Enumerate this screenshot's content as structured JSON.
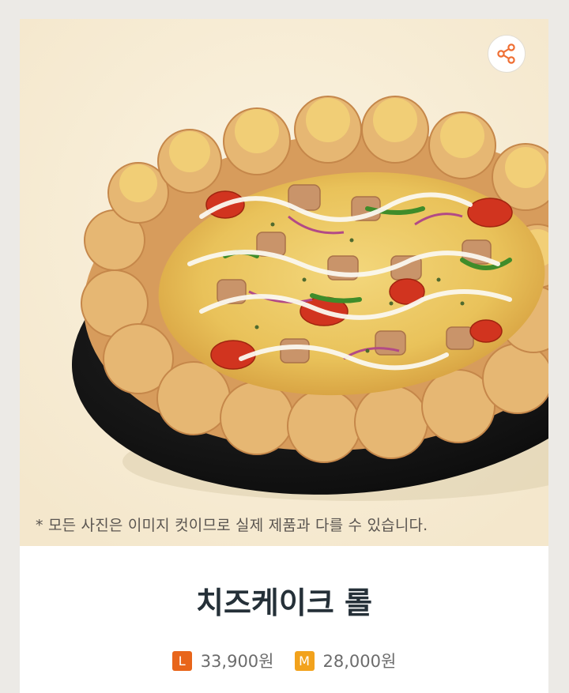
{
  "product": {
    "name": "치즈케이크 롤",
    "disclaimer": "* 모든 사진은 이미지 컷이므로 실제 제품과 다를 수 있습니다.",
    "image_alt": "pizza-photo"
  },
  "prices": [
    {
      "size": "L",
      "price": "33,900원",
      "badge_color": "#e8651a"
    },
    {
      "size": "M",
      "price": "28,000원",
      "badge_color": "#f2a21c"
    }
  ],
  "share": {
    "icon": "share-icon",
    "color": "#ef6f34"
  },
  "colors": {
    "hero_bg": "#f7edd6",
    "page_bg": "#eceae6",
    "title": "#253038"
  }
}
